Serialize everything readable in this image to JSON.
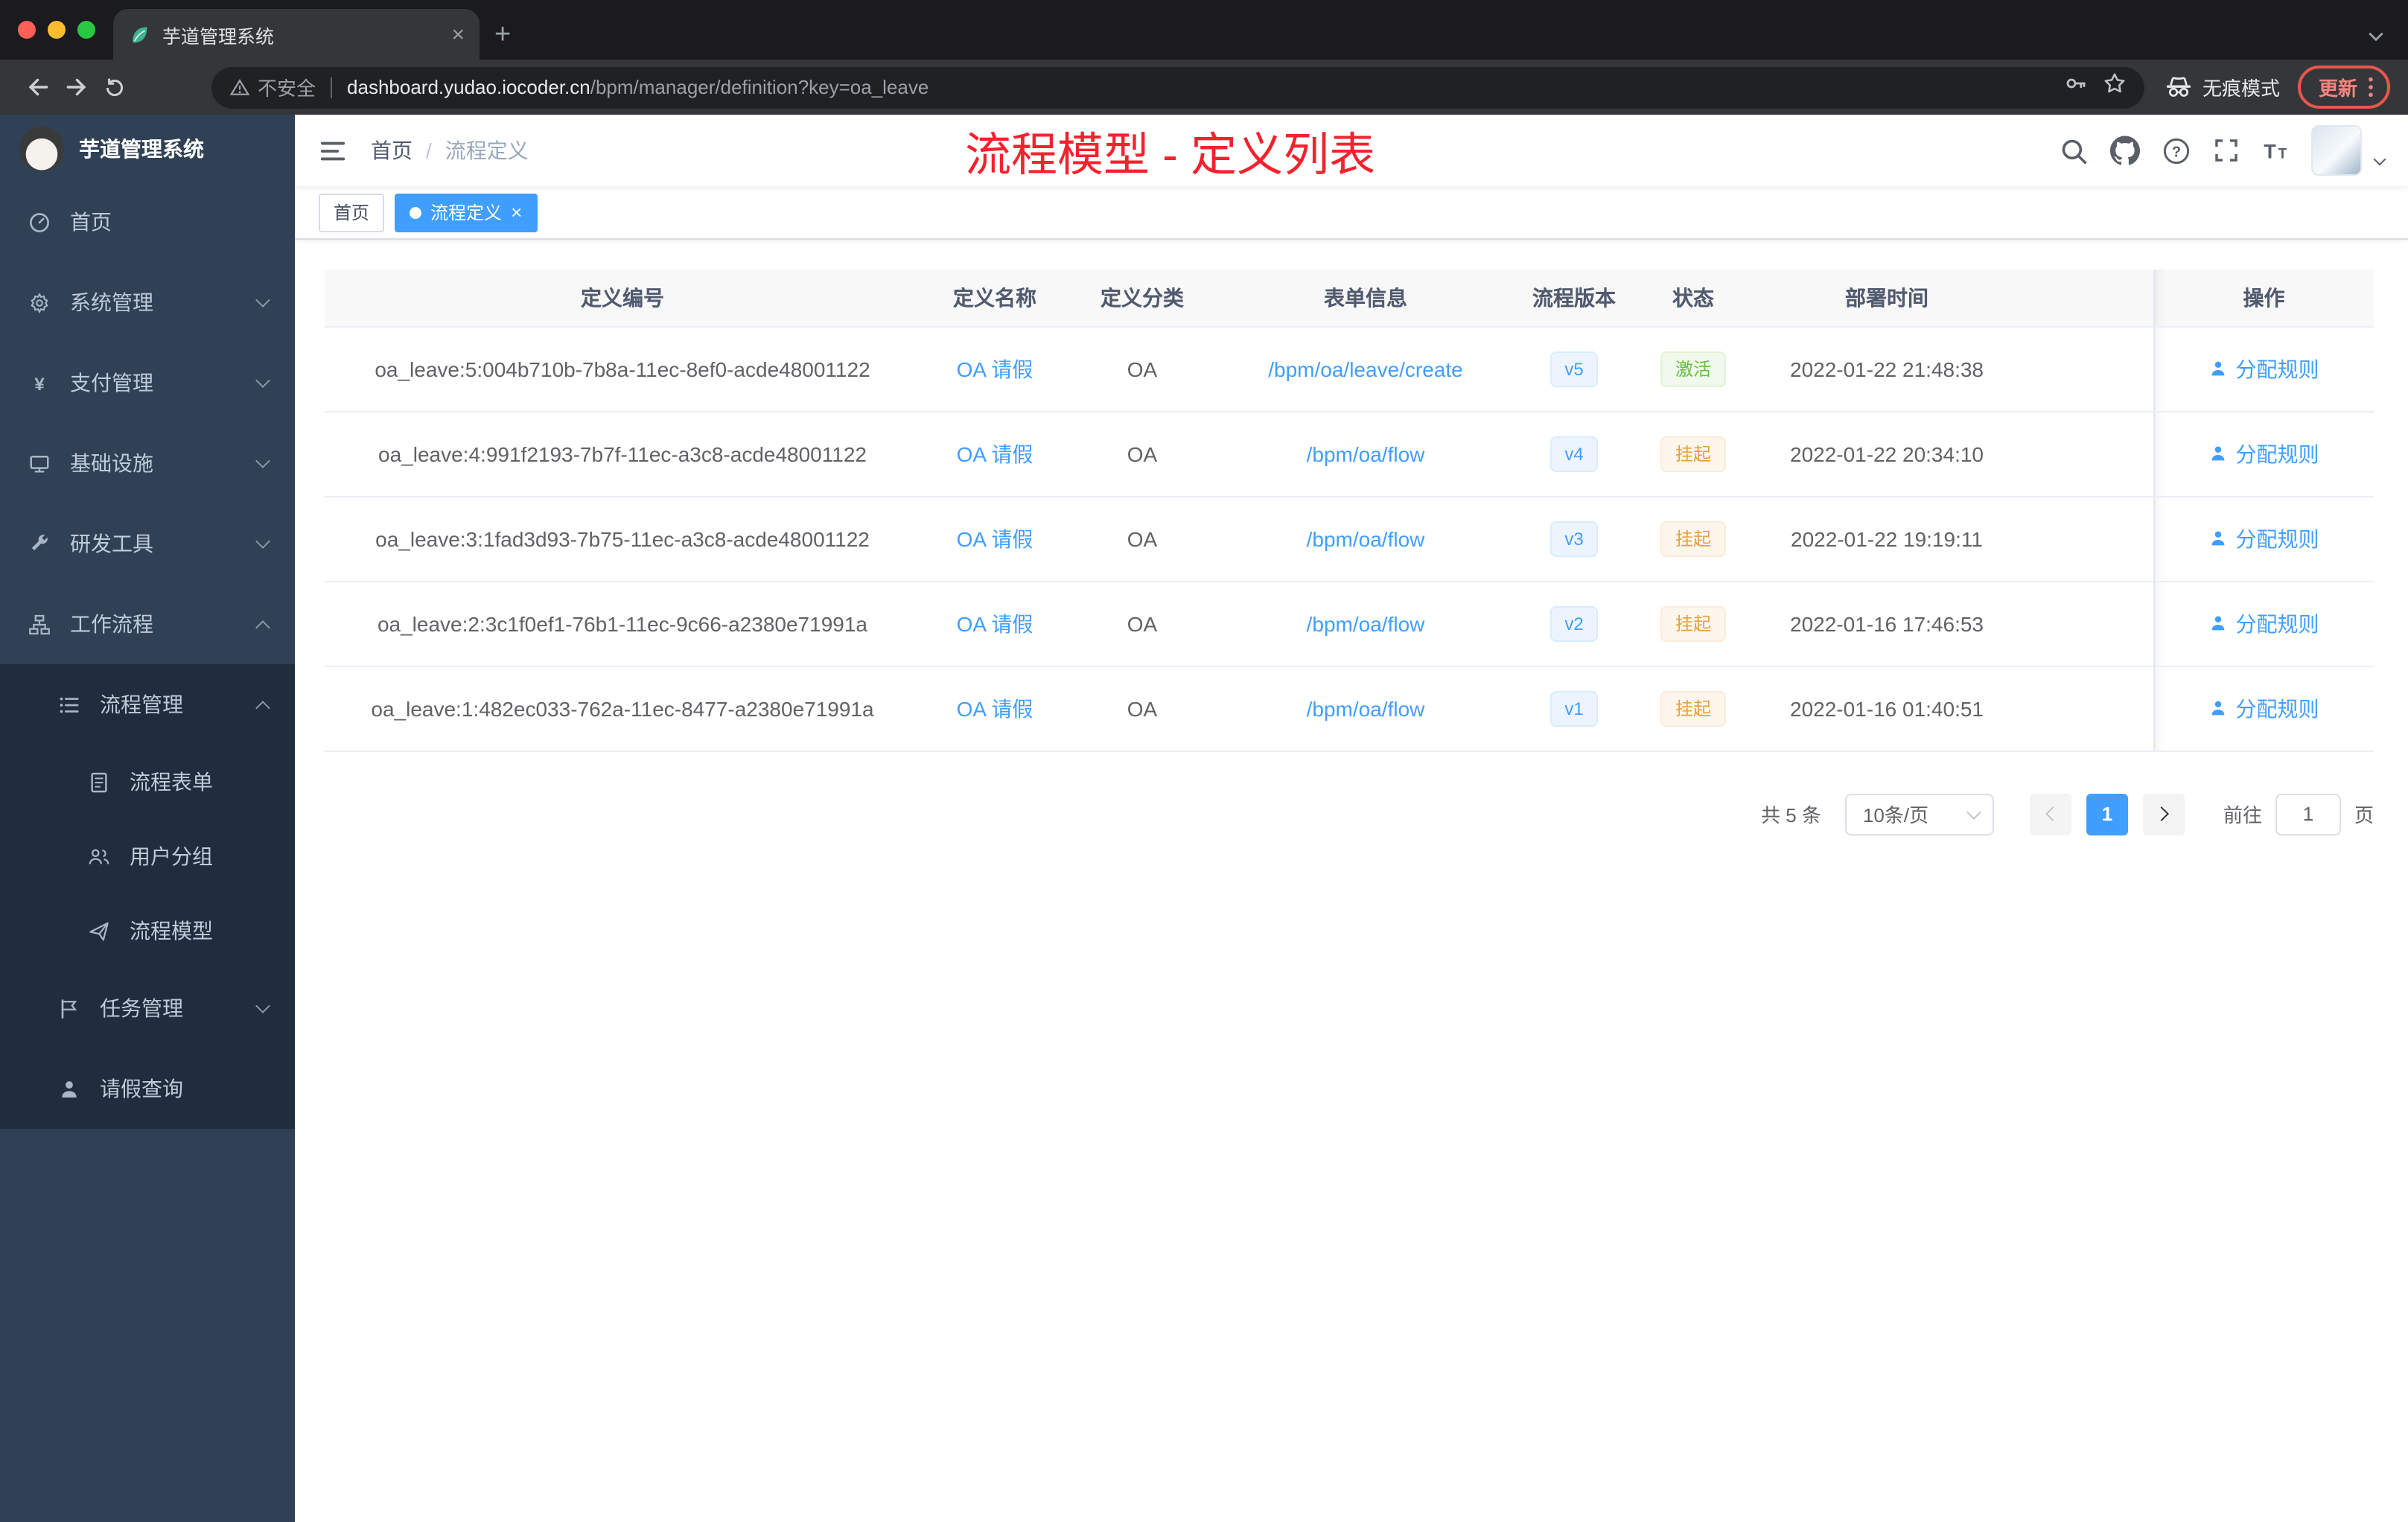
{
  "colors": {
    "accent": "#409eff",
    "annotation_red": "#f5222d",
    "sidebar_bg": "#304156",
    "submenu_bg": "#1f2d3d",
    "success": "#67c23a",
    "warning": "#e6a23c",
    "chrome_dark": "#1b1b1f",
    "chrome_toolbar": "#35363a"
  },
  "icons": {
    "tab_favicon": "leaf-icon",
    "security": "warning-triangle-icon",
    "omnibox_right": [
      "key-icon",
      "star-icon"
    ],
    "incognito": "spy-icon",
    "browser_menu": "vertical-dots-icon",
    "navbar_right": [
      "search-icon",
      "github-icon",
      "question-icon",
      "fullscreen-icon",
      "font-size-icon"
    ],
    "sidebar_menu": [
      "dashboard-icon",
      "gear-icon",
      "yen-icon",
      "monitor-icon",
      "wrench-icon",
      "tree-icon",
      "list-icon",
      "document-icon",
      "people-icon",
      "send-icon",
      "flag-icon",
      "person-icon"
    ],
    "table_action": "person-icon"
  },
  "browser": {
    "tab": {
      "title": "芋道管理系统"
    },
    "toolbar": {
      "security_label": "不安全",
      "url_host": "dashboard.yudao.iocoder.cn",
      "url_path": "/bpm/manager/definition?key=oa_leave",
      "incognito_label": "无痕模式",
      "update_label": "更新"
    }
  },
  "sidebar": {
    "logo_title": "芋道管理系统",
    "menu": [
      {
        "label": "首页"
      },
      {
        "label": "系统管理"
      },
      {
        "label": "支付管理"
      },
      {
        "label": "基础设施"
      },
      {
        "label": "研发工具"
      },
      {
        "label": "工作流程"
      },
      {
        "label": "流程管理"
      },
      {
        "label": "流程表单"
      },
      {
        "label": "用户分组"
      },
      {
        "label": "流程模型"
      },
      {
        "label": "任务管理"
      },
      {
        "label": "请假查询"
      }
    ]
  },
  "navbar": {
    "breadcrumb": {
      "home": "首页",
      "separator": "/",
      "current": "流程定义"
    },
    "annotation": "流程模型 - 定义列表"
  },
  "tags": [
    {
      "label": "首页",
      "active": false
    },
    {
      "label": "流程定义",
      "active": true
    }
  ],
  "table": {
    "columns": [
      "定义编号",
      "定义名称",
      "定义分类",
      "表单信息",
      "流程版本",
      "状态",
      "部署时间",
      "操作"
    ],
    "rows": [
      {
        "id": "oa_leave:5:004b710b-7b8a-11ec-8ef0-acde48001122",
        "name": "OA 请假",
        "category": "OA",
        "form": "/bpm/oa/leave/create",
        "version": "v5",
        "status": "激活",
        "status_type": "success",
        "time": "2022-01-22 21:48:38",
        "action": "分配规则"
      },
      {
        "id": "oa_leave:4:991f2193-7b7f-11ec-a3c8-acde48001122",
        "name": "OA 请假",
        "category": "OA",
        "form": "/bpm/oa/flow",
        "version": "v4",
        "status": "挂起",
        "status_type": "warning",
        "time": "2022-01-22 20:34:10",
        "action": "分配规则"
      },
      {
        "id": "oa_leave:3:1fad3d93-7b75-11ec-a3c8-acde48001122",
        "name": "OA 请假",
        "category": "OA",
        "form": "/bpm/oa/flow",
        "version": "v3",
        "status": "挂起",
        "status_type": "warning",
        "time": "2022-01-22 19:19:11",
        "action": "分配规则"
      },
      {
        "id": "oa_leave:2:3c1f0ef1-76b1-11ec-9c66-a2380e71991a",
        "name": "OA 请假",
        "category": "OA",
        "form": "/bpm/oa/flow",
        "version": "v2",
        "status": "挂起",
        "status_type": "warning",
        "time": "2022-01-16 17:46:53",
        "action": "分配规则"
      },
      {
        "id": "oa_leave:1:482ec033-762a-11ec-8477-a2380e71991a",
        "name": "OA 请假",
        "category": "OA",
        "form": "/bpm/oa/flow",
        "version": "v1",
        "status": "挂起",
        "status_type": "warning",
        "time": "2022-01-16 01:40:51",
        "action": "分配规则"
      }
    ]
  },
  "pagination": {
    "total": "共 5 条",
    "page_size": "10条/页",
    "current": "1",
    "goto_label": "前往",
    "goto_value": "1",
    "unit_label": "页"
  }
}
